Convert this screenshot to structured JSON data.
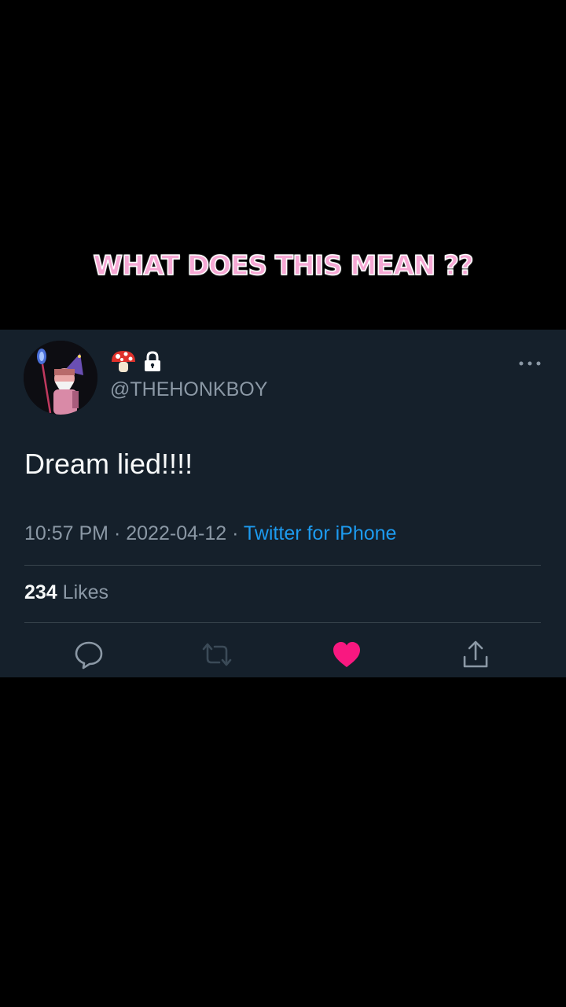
{
  "overlay": {
    "caption": "WHAT DOES THIS MEAN ??"
  },
  "tweet": {
    "handle": "@THEHONKBOY",
    "name_icons": [
      "mushroom-icon",
      "lock-icon"
    ],
    "text": "Dream lied!!!!",
    "time": "10:57 PM",
    "separator": "·",
    "date": "2022-04-12",
    "source": "Twitter for iPhone",
    "likes_count": "234",
    "likes_label": "Likes"
  },
  "actions": {
    "icons": [
      "reply-icon",
      "retweet-icon",
      "heart-icon",
      "share-icon"
    ],
    "liked": true
  },
  "colors": {
    "background": "#000000",
    "card": "#15202b",
    "primary_text": "#f7f9f9",
    "secondary_text": "#8b98a5",
    "link": "#1d9bf0",
    "like": "#f91880",
    "caption": "#f6a8d4"
  }
}
